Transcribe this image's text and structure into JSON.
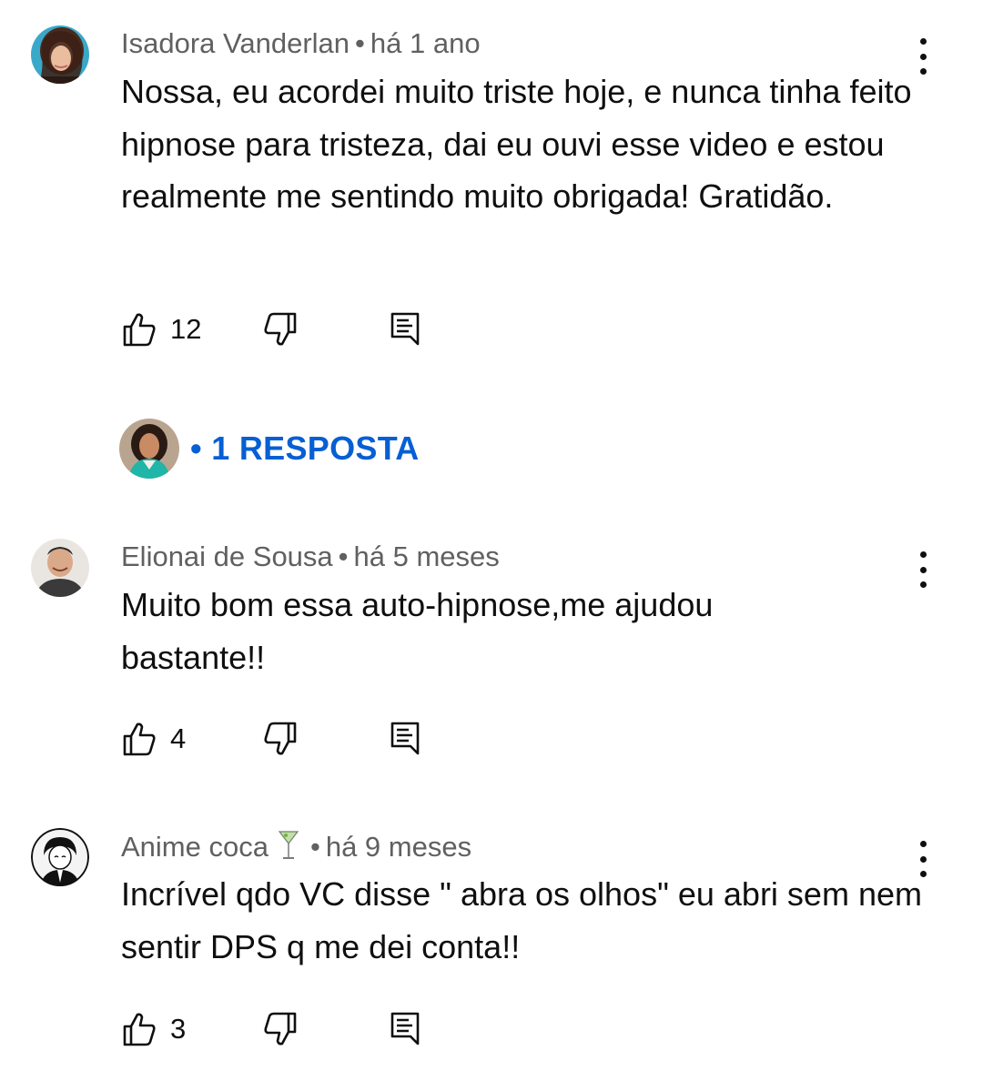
{
  "comments": [
    {
      "author": "Isadora Vanderlan",
      "time": "há 1 ano",
      "text": "Nossa, eu acordei muito triste hoje, e nunca tinha feito hipnose para tristeza, dai eu ouvi esse video e estou realmente me sentindo muito obrigada! Gratidão.",
      "likes": "12",
      "avatar_icon": "avatar-curly-hair-woman"
    },
    {
      "author": "Elionai de Sousa",
      "time": "há 5 meses",
      "text": "Muito bom essa auto-hipnose,me ajudou bastante!!",
      "likes": "4",
      "avatar_icon": "avatar-smiling-man"
    },
    {
      "author": "Anime coca",
      "author_emoji": "cocktail-glass-icon",
      "time": "há 9 meses",
      "text": "Incrível qdo VC disse \" abra os olhos\" eu abri sem nem sentir DPS q me dei conta!!",
      "likes": "3",
      "avatar_icon": "avatar-anime-drawing"
    }
  ],
  "replies": {
    "label": "1 RESPOSTA",
    "dot": "•",
    "avatar_icon": "avatar-woman-teal-shirt"
  },
  "separator": "•",
  "icons": {
    "like": "thumbs-up-icon",
    "dislike": "thumbs-down-icon",
    "reply": "comment-reply-icon",
    "menu": "more-vertical-icon"
  },
  "colors": {
    "text": "#0f0f0f",
    "meta": "#606060",
    "link": "#065fd4",
    "background": "#ffffff"
  }
}
